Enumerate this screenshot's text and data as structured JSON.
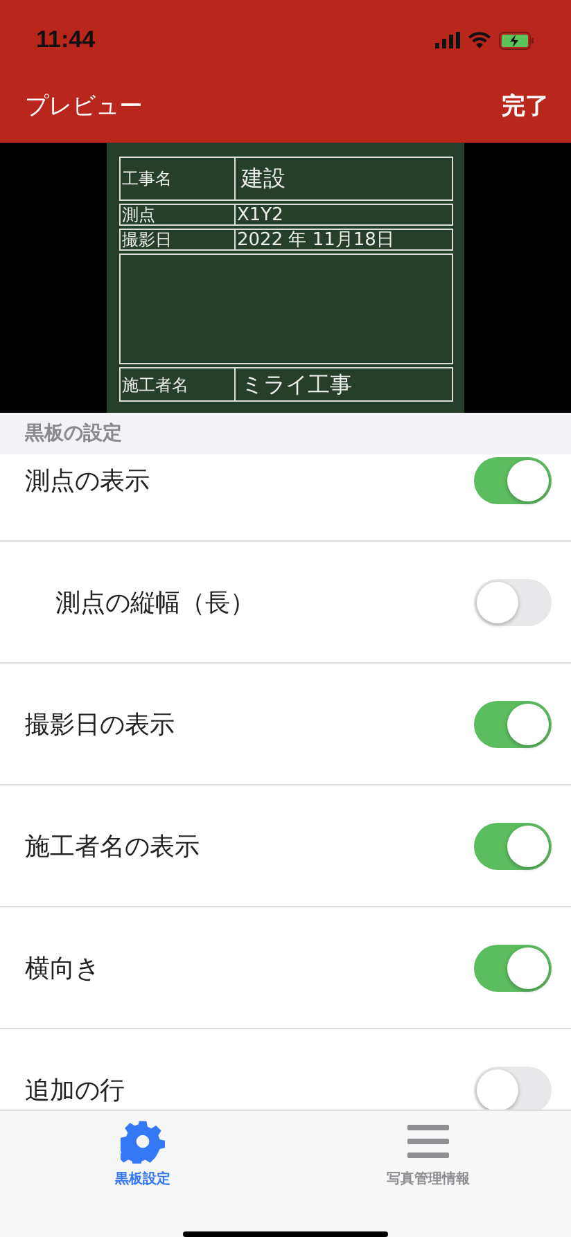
{
  "status_bar": {
    "time": "11:44"
  },
  "nav": {
    "title": "プレビュー",
    "done": "完了"
  },
  "board": {
    "rows": [
      {
        "kind": "title",
        "label": "工事名",
        "value": "建設"
      },
      {
        "kind": "small",
        "label": "測点",
        "value": "X1Y2"
      },
      {
        "kind": "small",
        "label": "撮影日",
        "value": "2022 年 11月18日"
      },
      {
        "kind": "blank"
      },
      {
        "kind": "title",
        "label": "施工者名",
        "value": "ミライ工事"
      }
    ]
  },
  "section": {
    "title": "黒板の設定"
  },
  "settings": [
    {
      "label": "測点の表示",
      "on": true,
      "children": [
        {
          "label": "測点の縦幅（長）",
          "on": false
        }
      ]
    },
    {
      "label": "撮影日の表示",
      "on": true
    },
    {
      "label": "施工者名の表示",
      "on": true
    },
    {
      "label": "横向き",
      "on": true
    },
    {
      "label": "追加の行",
      "on": false
    }
  ],
  "tabs": [
    {
      "label": "黒板設定",
      "selected": true,
      "kind": "gear"
    },
    {
      "label": "写真管理情報",
      "selected": false,
      "kind": "list"
    }
  ]
}
